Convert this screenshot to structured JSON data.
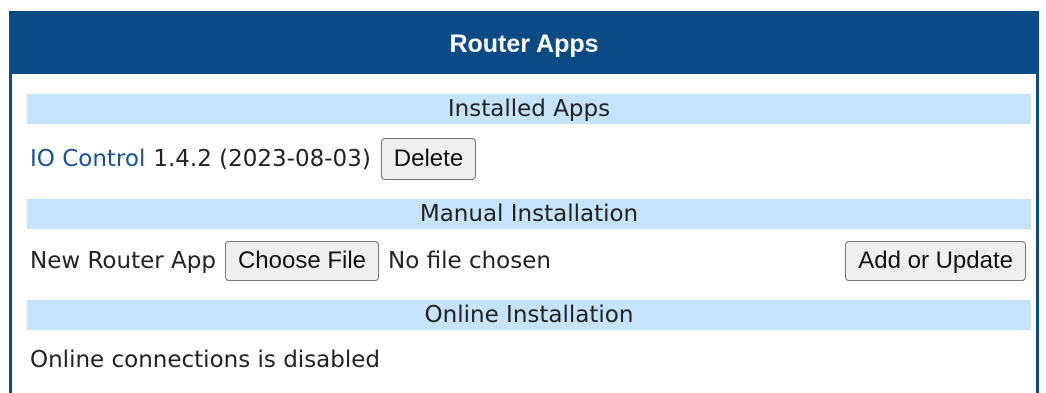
{
  "panel": {
    "title": "Router Apps"
  },
  "installed": {
    "section_label": "Installed Apps",
    "app_name": "IO Control",
    "app_version": "1.4.2 (2023-08-03)",
    "delete_label": "Delete"
  },
  "manual": {
    "section_label": "Manual Installation",
    "field_label": "New Router App",
    "choose_file_label": "Choose File",
    "file_status": "No file chosen",
    "add_update_label": "Add or Update"
  },
  "online": {
    "section_label": "Online Installation",
    "status_text": "Online connections is disabled"
  },
  "colors": {
    "header_bg": "#0a4a85",
    "section_bg": "#c5e3fb",
    "link": "#1a5296"
  }
}
